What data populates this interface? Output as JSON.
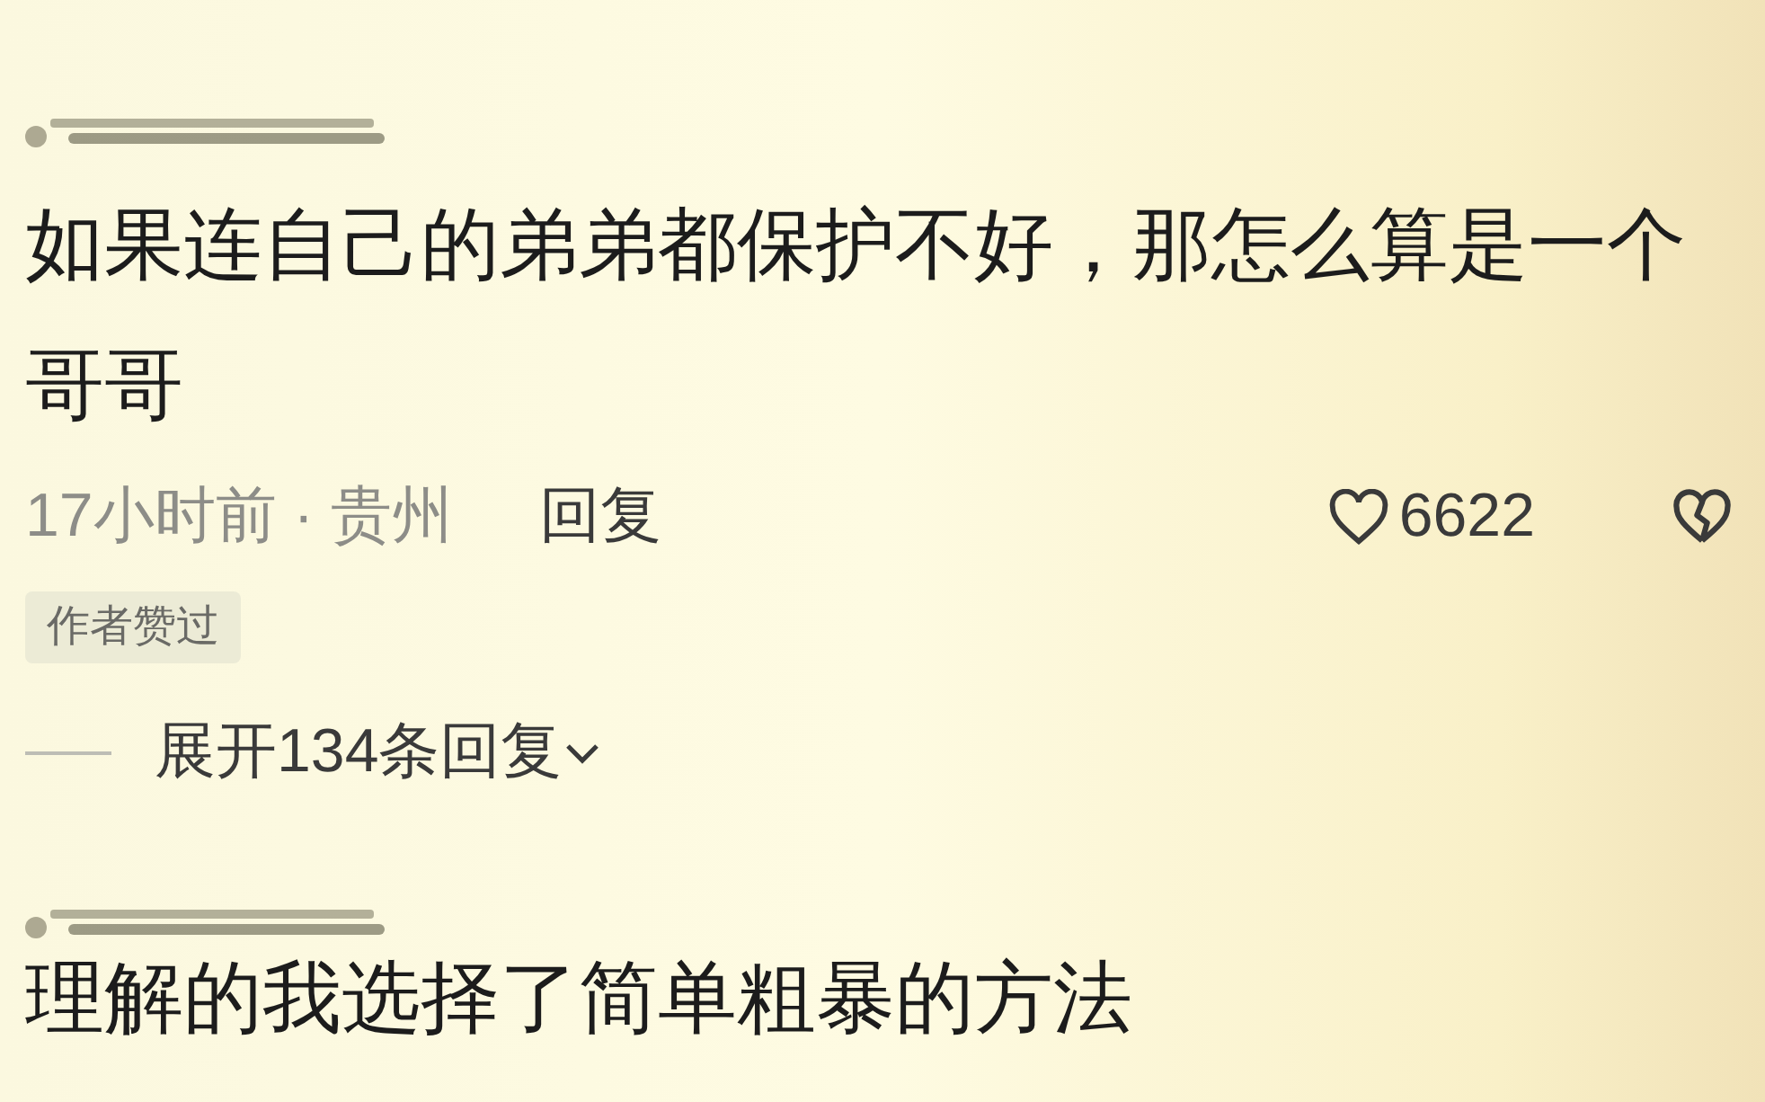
{
  "comments": [
    {
      "text": "如果连自己的弟弟都保护不好，那怎么算是一个哥哥",
      "meta": "17小时前 · 贵州",
      "reply": "回复",
      "likes": "6622",
      "badge": "作者赞过",
      "expand": "展开134条回复"
    },
    {
      "text": "理解的我选择了简单粗暴的方法"
    }
  ]
}
